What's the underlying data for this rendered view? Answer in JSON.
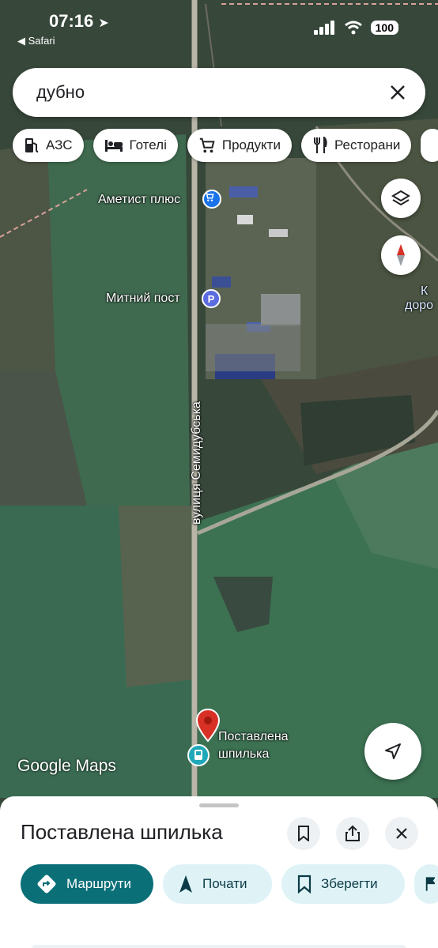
{
  "status_bar": {
    "time": "07:16",
    "back_app": "◀ Safari",
    "battery": "100"
  },
  "search": {
    "query": "дубно",
    "close_icon": "close-icon"
  },
  "chips": [
    {
      "icon": "fuel-icon",
      "label": "АЗС"
    },
    {
      "icon": "hotel-icon",
      "label": "Готелі"
    },
    {
      "icon": "cart-icon",
      "label": "Продукти"
    },
    {
      "icon": "restaurant-icon",
      "label": "Ресторани"
    }
  ],
  "map": {
    "poi_store": "Аметист плюс",
    "poi_parking": "Митний пост",
    "parking_letter": "P",
    "street": "вулиця Семидубська",
    "dropped_pin_label_line1": "Поставлена",
    "dropped_pin_label_line2": "шпилька",
    "edge_label_line1": "К",
    "edge_label_line2": "доро",
    "logo": "Google Maps"
  },
  "sheet": {
    "title": "Поставлена шпилька",
    "actions": [
      {
        "icon": "directions-icon",
        "label": "Маршрути"
      },
      {
        "icon": "navigation-icon",
        "label": "Почати"
      },
      {
        "icon": "bookmark-icon",
        "label": "Зберегти"
      }
    ]
  },
  "colors": {
    "accent": "#0b6f78",
    "secondary_button": "#dff3f7",
    "pin": "#d93025",
    "store_poi": "#1a73e8",
    "parking_poi": "#5b6be0"
  }
}
